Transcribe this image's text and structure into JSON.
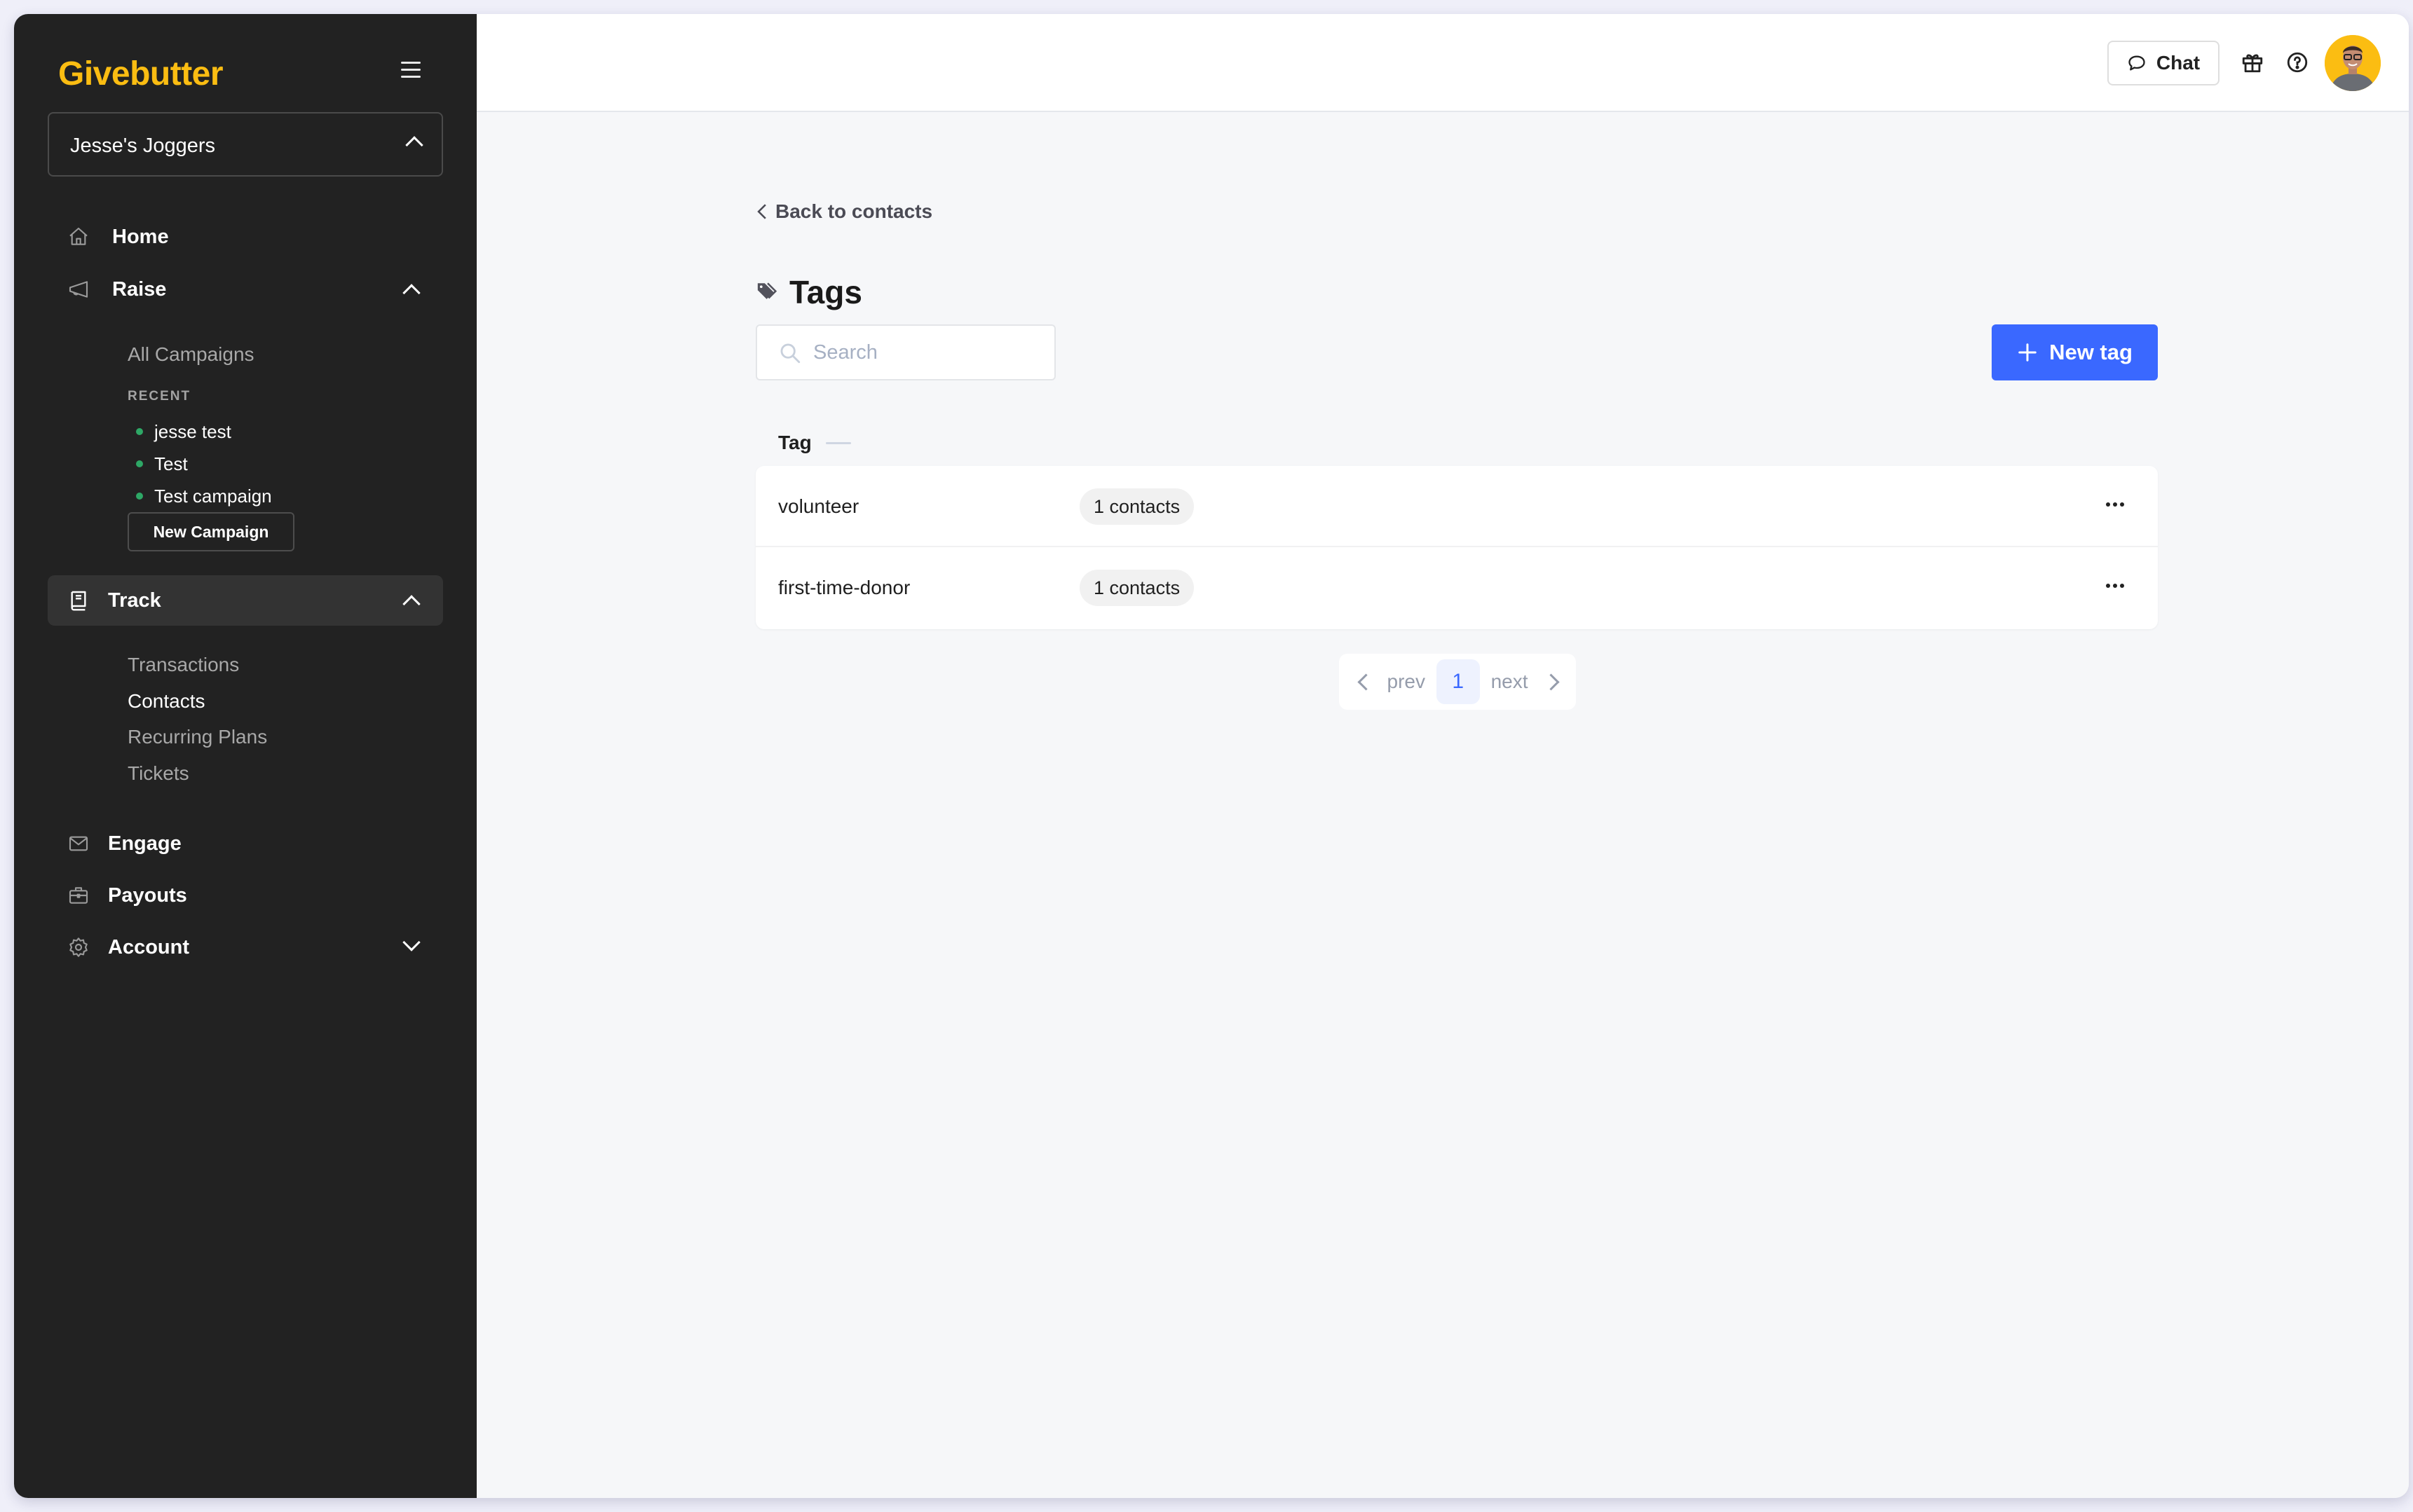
{
  "app": {
    "brand": "Givebutter",
    "brand_color": "#fbbd12",
    "accent_color": "#3a68ff"
  },
  "sidebar": {
    "menu_icon": "hamburger-icon",
    "org_select": {
      "value": "Jesse's Joggers"
    },
    "nav": {
      "home": {
        "label": "Home",
        "icon": "home-icon"
      },
      "raise": {
        "label": "Raise",
        "icon": "megaphone-icon",
        "expanded": true,
        "items": [
          {
            "label": "All Campaigns"
          }
        ],
        "recent_label": "RECENT",
        "recent": [
          {
            "label": "jesse test",
            "status_color": "#2ea866"
          },
          {
            "label": "Test",
            "status_color": "#2ea866"
          },
          {
            "label": "Test campaign",
            "status_color": "#2ea866"
          }
        ],
        "new_campaign_label": "New Campaign"
      },
      "track": {
        "label": "Track",
        "icon": "book-icon",
        "expanded": true,
        "active": true,
        "items": [
          {
            "label": "Transactions"
          },
          {
            "label": "Contacts",
            "current": true
          },
          {
            "label": "Recurring Plans"
          },
          {
            "label": "Tickets"
          }
        ]
      },
      "engage": {
        "label": "Engage",
        "icon": "mail-icon"
      },
      "payouts": {
        "label": "Payouts",
        "icon": "briefcase-icon"
      },
      "account": {
        "label": "Account",
        "icon": "gear-icon",
        "expanded": false
      }
    }
  },
  "topbar": {
    "chat_label": "Chat",
    "icons": [
      "chat-bubble-icon",
      "gift-icon",
      "help-icon"
    ],
    "avatar": "user-avatar"
  },
  "main": {
    "back_link": "Back to contacts",
    "title": "Tags",
    "search": {
      "placeholder": "Search",
      "value": ""
    },
    "new_tag_label": "New tag",
    "column_header": "Tag",
    "rows": [
      {
        "name": "volunteer",
        "count_label": "1 contacts"
      },
      {
        "name": "first-time-donor",
        "count_label": "1 contacts"
      }
    ],
    "pagination": {
      "prev_label": "prev",
      "next_label": "next",
      "current_page": "1"
    }
  }
}
